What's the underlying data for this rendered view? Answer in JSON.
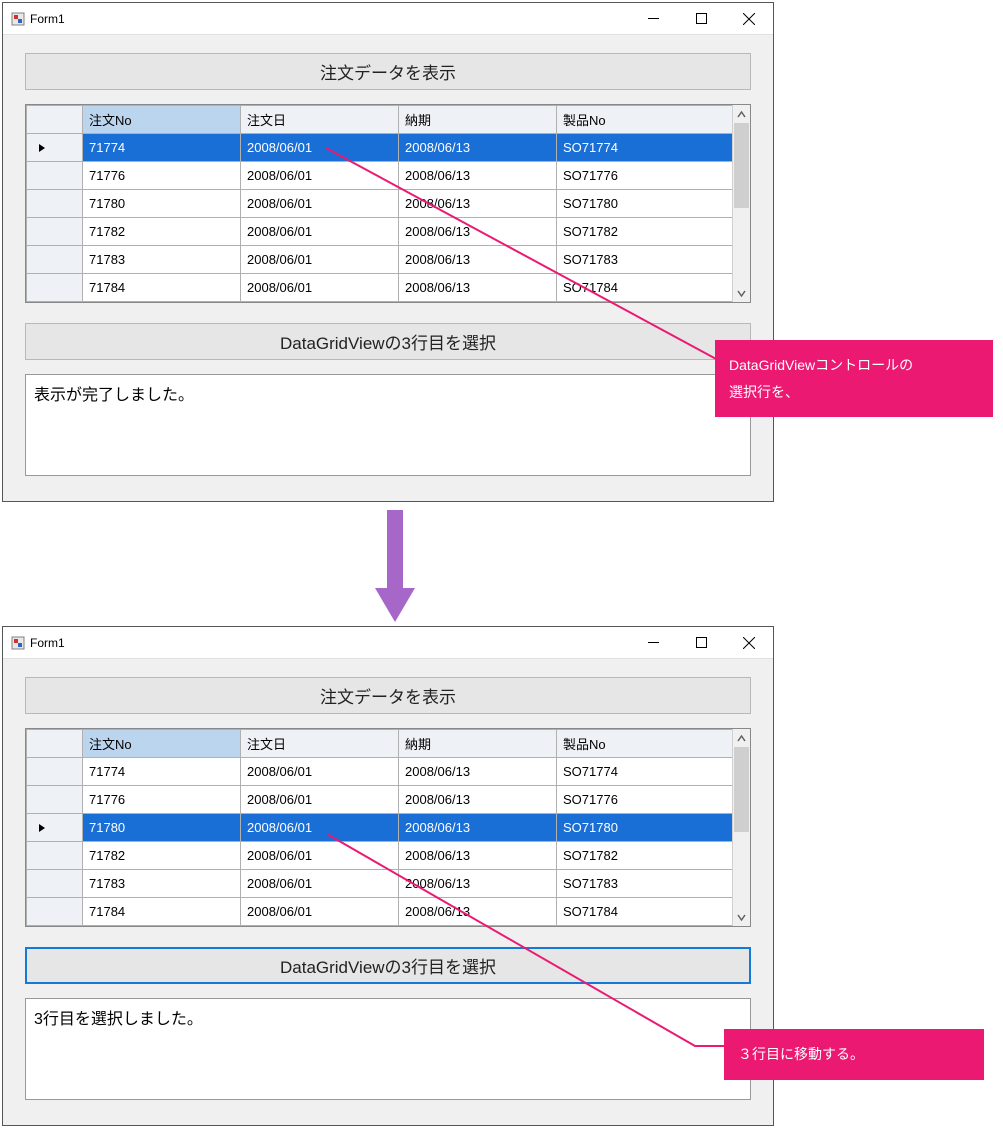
{
  "colors": {
    "select_blue": "#1a6fd6",
    "callout_pink": "#ec1972",
    "arrow_purple": "#a767c8"
  },
  "window1": {
    "title": "Form1",
    "button1_label": "注文データを表示",
    "button2_label": "DataGridViewの3行目を選択",
    "status_text": "表示が完了しました。",
    "grid": {
      "selected_index": 0,
      "active_column": 0,
      "columns": [
        "注文No",
        "注文日",
        "納期",
        "製品No"
      ],
      "rows": [
        {
          "no": "71774",
          "d1": "2008/06/01",
          "d2": "2008/06/13",
          "pn": "SO71774"
        },
        {
          "no": "71776",
          "d1": "2008/06/01",
          "d2": "2008/06/13",
          "pn": "SO71776"
        },
        {
          "no": "71780",
          "d1": "2008/06/01",
          "d2": "2008/06/13",
          "pn": "SO71780"
        },
        {
          "no": "71782",
          "d1": "2008/06/01",
          "d2": "2008/06/13",
          "pn": "SO71782"
        },
        {
          "no": "71783",
          "d1": "2008/06/01",
          "d2": "2008/06/13",
          "pn": "SO71783"
        },
        {
          "no": "71784",
          "d1": "2008/06/01",
          "d2": "2008/06/13",
          "pn": "SO71784"
        }
      ]
    }
  },
  "window2": {
    "title": "Form1",
    "button1_label": "注文データを表示",
    "button2_label": "DataGridViewの3行目を選択",
    "button2_focused": true,
    "status_text": "3行目を選択しました。",
    "grid": {
      "selected_index": 2,
      "active_column": 0,
      "columns": [
        "注文No",
        "注文日",
        "納期",
        "製品No"
      ],
      "rows": [
        {
          "no": "71774",
          "d1": "2008/06/01",
          "d2": "2008/06/13",
          "pn": "SO71774"
        },
        {
          "no": "71776",
          "d1": "2008/06/01",
          "d2": "2008/06/13",
          "pn": "SO71776"
        },
        {
          "no": "71780",
          "d1": "2008/06/01",
          "d2": "2008/06/13",
          "pn": "SO71780"
        },
        {
          "no": "71782",
          "d1": "2008/06/01",
          "d2": "2008/06/13",
          "pn": "SO71782"
        },
        {
          "no": "71783",
          "d1": "2008/06/01",
          "d2": "2008/06/13",
          "pn": "SO71783"
        },
        {
          "no": "71784",
          "d1": "2008/06/01",
          "d2": "2008/06/13",
          "pn": "SO71784"
        }
      ]
    }
  },
  "callout1_text": "DataGridViewコントロールの\n選択行を、",
  "callout2_text": "３行目に移動する。"
}
